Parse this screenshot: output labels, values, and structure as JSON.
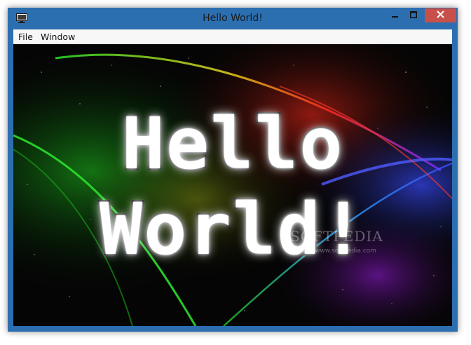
{
  "window": {
    "title": "Hello World!"
  },
  "menu": {
    "file": "File",
    "window": "Window"
  },
  "content": {
    "line1": "Hello",
    "line2": "World!",
    "watermark": "SOFTPEDIA",
    "watermark_sub": "www.softpedia.com"
  },
  "icons": {
    "app": "monitor-icon",
    "minimize": "minimize-icon",
    "maximize": "maximize-icon",
    "close": "close-icon"
  },
  "colors": {
    "frame": "#2c6fb1",
    "close_button": "#c7504a",
    "menubar": "#f7f7f7",
    "text_fill": "#ffffff",
    "text_outline": "#0a0a0a"
  }
}
